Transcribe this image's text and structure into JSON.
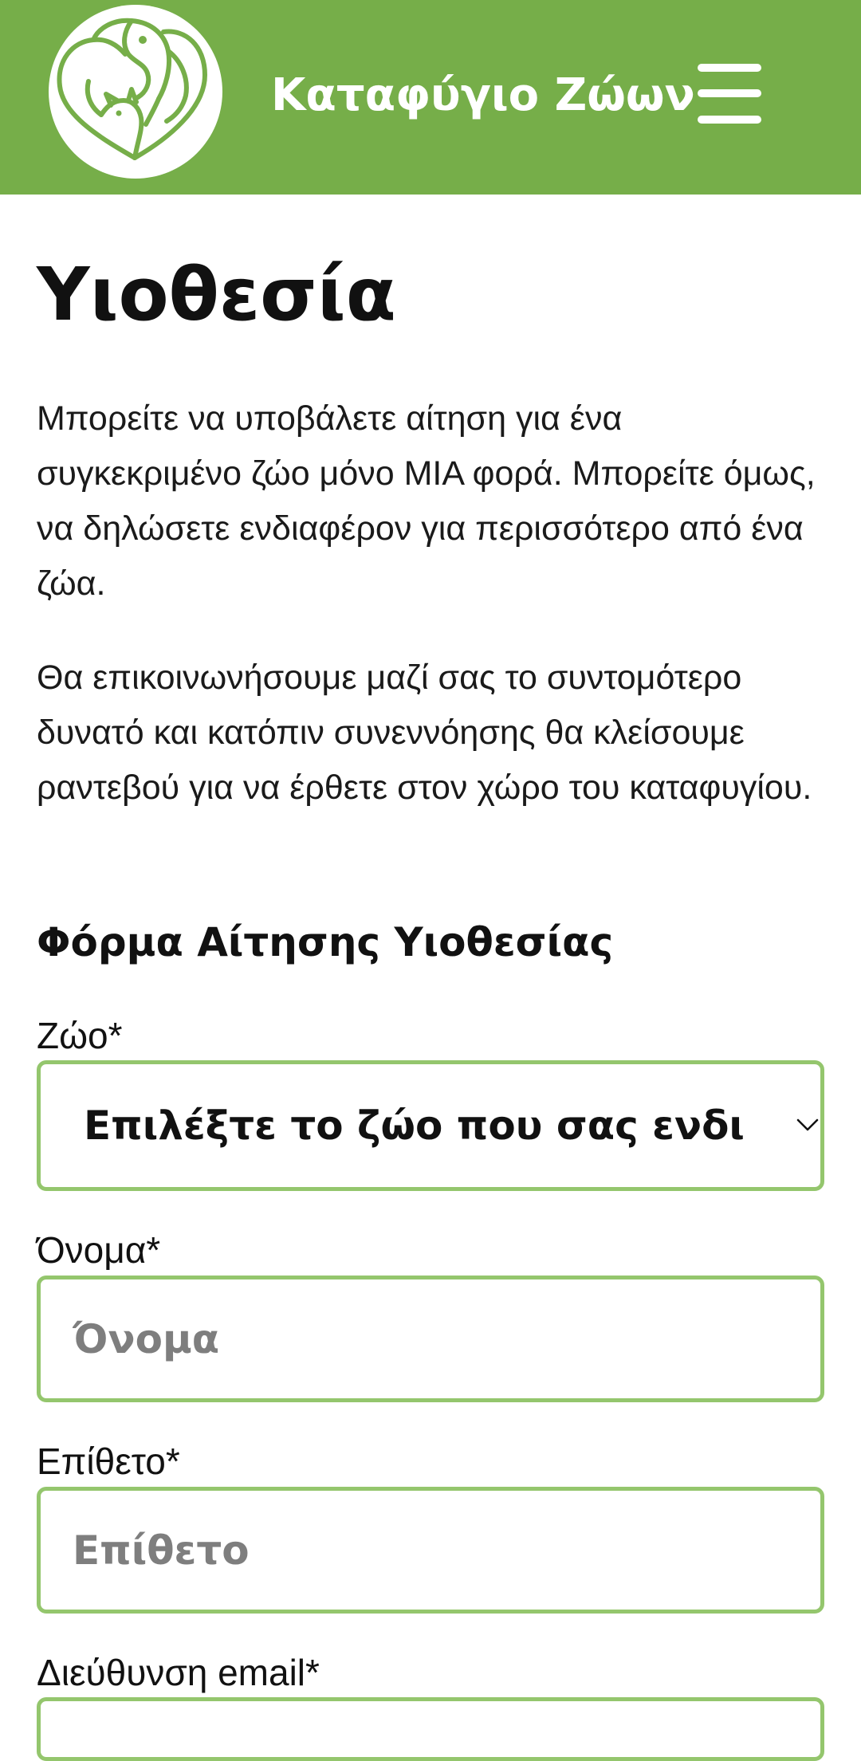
{
  "header": {
    "brand": "Καταφύγιο Ζώων",
    "logo_icon": "dog-cat-heart-logo-icon",
    "menu_icon": "hamburger-menu-icon",
    "background_color": "#76ae49"
  },
  "main": {
    "title": "Υιοθεσία",
    "paragraphs": [
      "Μπορείτε να υποβάλετε αίτηση για ένα συγκεκριμένο ζώο μόνο ΜΙΑ φορά. Μπορείτε όμως, να δηλώσετε ενδιαφέρον για περισσότερο από ένα ζώα.",
      "Θα επικοινωνήσουμε μαζί σας το συντομότερο δυνατό και κατόπιν συνεννόησης θα κλείσουμε ραντεβού για να έρθετε στον χώρο του καταφυγίου."
    ]
  },
  "form": {
    "title": "Φόρμα Αίτησης Υιοθεσίας",
    "border_color": "#94c66d",
    "animal": {
      "label": "Ζώο*",
      "selected": "Επιλέξτε το ζώο που σας ενδιαφ",
      "chevron_icon": "chevron-down-icon"
    },
    "first_name": {
      "label": "Όνομα*",
      "value": "",
      "placeholder": "Όνομα"
    },
    "last_name": {
      "label": "Επίθετο*",
      "value": "",
      "placeholder": "Επίθετο"
    },
    "email": {
      "label": "Διεύθυνση email*",
      "value": "",
      "placeholder": ""
    }
  }
}
